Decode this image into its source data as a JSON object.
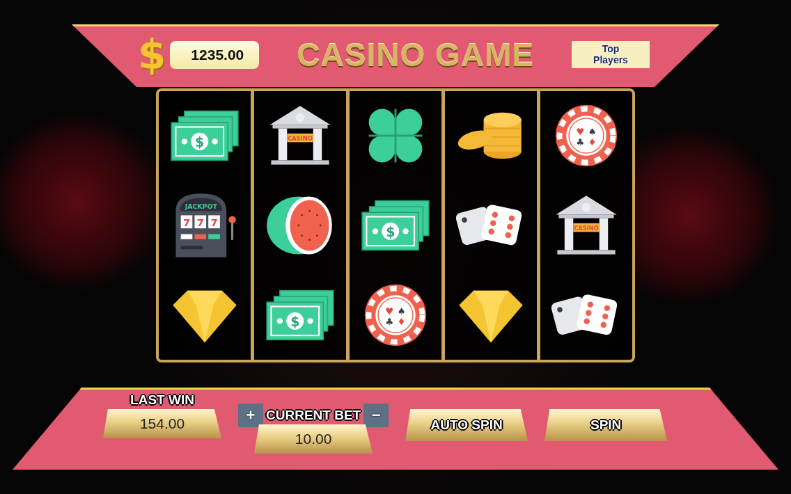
{
  "header": {
    "currency_symbol": "$",
    "balance": "1235.00",
    "title": "CASINO GAME",
    "top_players_button": "Top Players"
  },
  "reels": [
    {
      "symbols": [
        {
          "kind": "cash",
          "mark": "$"
        },
        {
          "kind": "slot",
          "sign": "JACKPOT",
          "digits": [
            "7",
            "7",
            "7"
          ]
        },
        {
          "kind": "gem"
        }
      ]
    },
    {
      "symbols": [
        {
          "kind": "bank",
          "sign": "CASINO"
        },
        {
          "kind": "melon"
        },
        {
          "kind": "cash",
          "mark": "$"
        }
      ]
    },
    {
      "symbols": [
        {
          "kind": "clover"
        },
        {
          "kind": "cash",
          "mark": "$"
        },
        {
          "kind": "chip",
          "suits": [
            "♥",
            "♠",
            "♣",
            "♦"
          ]
        }
      ]
    },
    {
      "symbols": [
        {
          "kind": "coins"
        },
        {
          "kind": "dice"
        },
        {
          "kind": "gem"
        }
      ]
    },
    {
      "symbols": [
        {
          "kind": "chip",
          "suits": [
            "♥",
            "♠",
            "♣",
            "♦"
          ]
        },
        {
          "kind": "bank",
          "sign": "CASINO"
        },
        {
          "kind": "dice"
        }
      ]
    }
  ],
  "controls": {
    "last_win": {
      "label": "LAST WIN",
      "value": "154.00"
    },
    "current_bet": {
      "increase": "+",
      "label": "CURRENT BET",
      "decrease": "−",
      "value": "10.00"
    },
    "buttons": [
      {
        "label": "AUTO SPIN"
      },
      {
        "label": "SPIN"
      }
    ]
  }
}
